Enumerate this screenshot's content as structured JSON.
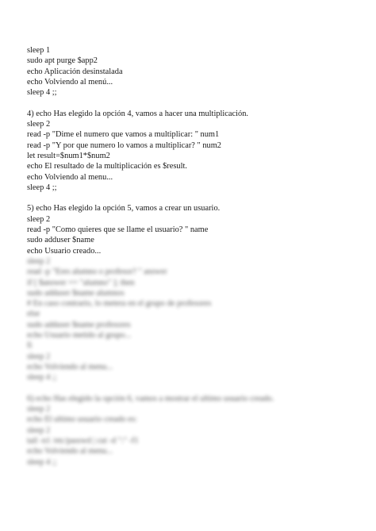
{
  "visible_lines": [
    "sleep 1",
    "sudo apt purge $app2",
    "echo Aplicación desinstalada",
    "echo Volviendo al menú...",
    "sleep 4 ;;",
    "",
    "4) echo Has elegido la opción 4, vamos a hacer una multiplicación.",
    "sleep 2",
    "read -p \"Dime el numero que vamos a multiplicar: \" num1",
    "read -p \"Y por que numero lo vamos a multiplicar? \" num2",
    "let result=$num1*$num2",
    "echo El resultado de la multiplicación es $result.",
    "echo Volviendo al menu...",
    "sleep 4 ;;",
    "",
    "5) echo Has elegido la opción 5, vamos a crear un usuario.",
    "sleep 2",
    "read -p \"Como quieres que se llame el usuario? \" name",
    "sudo adduser $name",
    "echo Usuario creado..."
  ],
  "blurred_lines": [
    "sleep 2",
    "read -p \"Eres alumno o profesor? \" answer",
    "if [ $answer == \"alumno\" ]; then",
    "sudo adduser $name alumnos",
    "# En caso contrario, lo metera en el grupo de profesores",
    "else",
    "sudo adduser $name profesores",
    "echo Usuario metido al grupo...",
    "fi",
    "sleep 2",
    "echo Volviendo al menu...",
    "sleep 4 ;;",
    "",
    "6) echo Has elegido la opción 6, vamos a mostrar el ultimo usuario creado.",
    "sleep 2",
    "echo El ultimo usuario creado es:",
    "sleep 2",
    "tail -n1 /etc/passwd | cut -d \":\" -f1",
    "echo Volviendo al menu...",
    "sleep 4 ;;"
  ]
}
